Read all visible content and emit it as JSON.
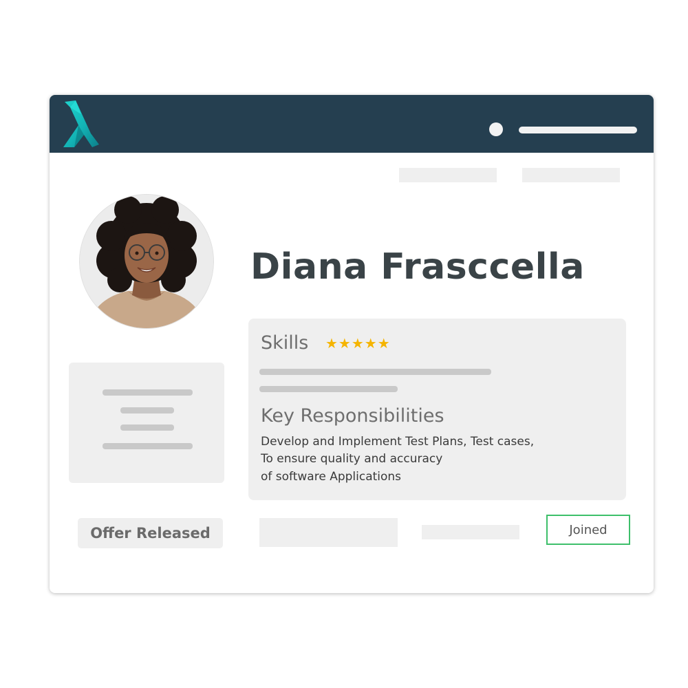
{
  "header": {
    "logo_icon": "lambda-logo-icon",
    "status_icon": "status-dot-icon"
  },
  "profile": {
    "name": "Diana Frasccella",
    "avatar_icon": "profile-photo"
  },
  "skills": {
    "title": "Skills",
    "rating_stars": "★★★★★",
    "rating": 5,
    "rating_max": 5,
    "star_color": "#f5b400"
  },
  "responsibilities": {
    "title": "Key Responsibilities",
    "lines": [
      "Develop and Implement Test Plans, Test cases,",
      "To ensure quality and accuracy",
      "of software Applications"
    ]
  },
  "status": {
    "offer_label": "Offer Released",
    "joined_label": "Joined",
    "joined_color": "#3dbf6a"
  },
  "colors": {
    "header_bg": "#253f50",
    "logo_accent": "#19c9c4",
    "name_text": "#3a4347"
  }
}
